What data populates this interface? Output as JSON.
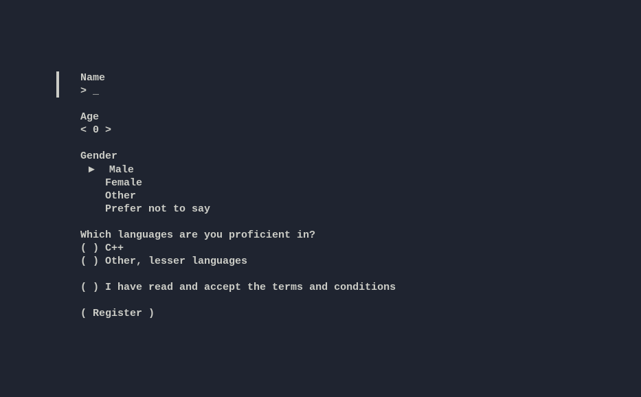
{
  "form": {
    "name": {
      "label": "Name",
      "prompt": "> ",
      "value": "",
      "cursor": "_"
    },
    "age": {
      "label": "Age",
      "value": 0,
      "display": "< 0 >"
    },
    "gender": {
      "label": "Gender",
      "options": [
        {
          "label": "Male",
          "selected": true
        },
        {
          "label": "Female",
          "selected": false
        },
        {
          "label": "Other",
          "selected": false
        },
        {
          "label": "Prefer not to say",
          "selected": false
        }
      ]
    },
    "languages": {
      "label": "Which languages are you proficient in?",
      "options": [
        {
          "label": "C++",
          "checked": false
        },
        {
          "label": "Other, lesser languages",
          "checked": false
        }
      ]
    },
    "terms": {
      "label": "I have read and accept the terms and conditions",
      "checked": false
    },
    "submit": {
      "label": "Register"
    }
  }
}
